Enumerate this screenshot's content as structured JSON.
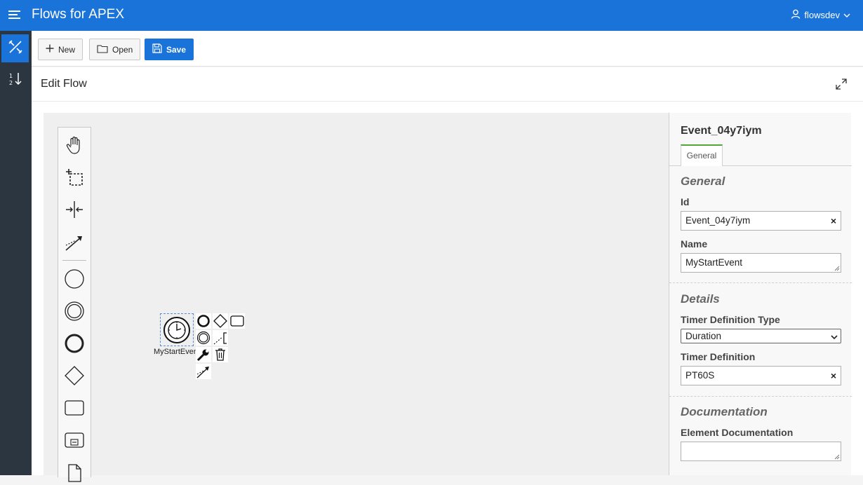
{
  "app": {
    "title": "Flows for APEX",
    "user": "flowsdev"
  },
  "toolbar": {
    "new_label": "New",
    "open_label": "Open",
    "save_label": "Save"
  },
  "region": {
    "title": "Edit Flow"
  },
  "diagram": {
    "event_label": "MyStartEvent"
  },
  "properties": {
    "element_id": "Event_04y7iym",
    "tab_general": "General",
    "general": {
      "title": "General",
      "id_label": "Id",
      "id_value": "Event_04y7iym",
      "name_label": "Name",
      "name_value": "MyStartEvent"
    },
    "details": {
      "title": "Details",
      "timer_type_label": "Timer Definition Type",
      "timer_type_value": "Duration",
      "timer_def_label": "Timer Definition",
      "timer_def_value": "PT60S"
    },
    "documentation": {
      "title": "Documentation",
      "element_doc_label": "Element Documentation",
      "element_doc_value": ""
    }
  },
  "colors": {
    "header": "#1a73d9",
    "sidebar": "#2b3640",
    "tab_accent": "#52a635"
  }
}
